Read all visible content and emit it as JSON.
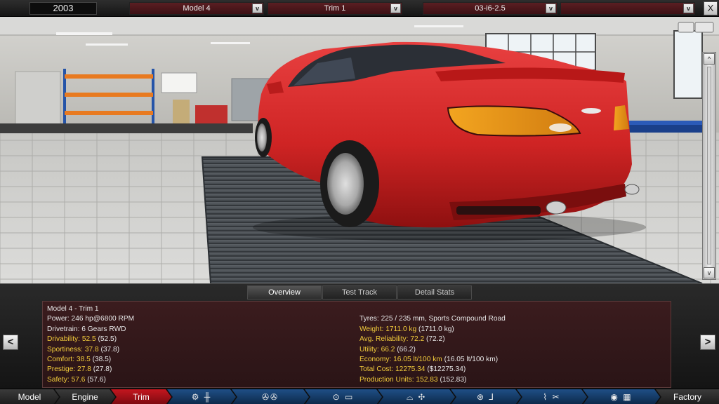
{
  "topbar": {
    "year": "2003",
    "model": "Model 4",
    "trim": "Trim 1",
    "engine": "03-i6-2.5",
    "extra": "",
    "dropdown_arrow": "v",
    "close_label": "X"
  },
  "viewport": {
    "scroll_up": "^",
    "scroll_down": "v"
  },
  "panel": {
    "tabs": [
      "Overview",
      "Test Track",
      "Detail Stats"
    ],
    "active_tab": "Overview",
    "prev_label": "<",
    "next_label": ">",
    "title": "Model 4 - Trim 1",
    "left": [
      {
        "label": "Power: 246 hp@6800 RPM",
        "value": "",
        "paren": "",
        "highlight": false
      },
      {
        "label": "Drivetrain: 6 Gears RWD",
        "value": "",
        "paren": "",
        "highlight": false
      },
      {
        "label": "Drivability:",
        "value": "52.5",
        "paren": "(52.5)",
        "highlight": true
      },
      {
        "label": "Sportiness:",
        "value": "37.8",
        "paren": "(37.8)",
        "highlight": true
      },
      {
        "label": "Comfort:",
        "value": "38.5",
        "paren": "(38.5)",
        "highlight": true
      },
      {
        "label": "Prestige:",
        "value": "27.8",
        "paren": "(27.8)",
        "highlight": true
      },
      {
        "label": "Safety:",
        "value": "57.6",
        "paren": "(57.6)",
        "highlight": true
      }
    ],
    "right": [
      {
        "label": "",
        "value": "",
        "paren": "",
        "highlight": false
      },
      {
        "label": "Tyres: 225 / 235 mm, Sports Compound Road",
        "value": "",
        "paren": "",
        "highlight": false
      },
      {
        "label": "Weight:",
        "value": "1711.0 kg",
        "paren": "(1711.0 kg)",
        "highlight": true
      },
      {
        "label": "Avg. Reliability:",
        "value": "72.2",
        "paren": "(72.2)",
        "highlight": true
      },
      {
        "label": "Utility:",
        "value": "66.2",
        "paren": "(66.2)",
        "highlight": true
      },
      {
        "label": "Economy:",
        "value": "16.05 lt/100 km",
        "paren": "(16.05 lt/100 km)",
        "highlight": true
      },
      {
        "label": "Total Cost:",
        "value": "12275.34",
        "paren": "($12275.34)",
        "highlight": true
      },
      {
        "label": "Production Units:",
        "value": "152.83",
        "paren": "(152.83)",
        "highlight": true
      }
    ]
  },
  "bottomnav": {
    "model": "Model",
    "engine": "Engine",
    "trim": "Trim",
    "factory": "Factory",
    "icons": [
      "gearbox-icon",
      "wheels-icon",
      "body-icon",
      "aero-icon",
      "interior-icon",
      "suspension-icon",
      "test-flag-icon"
    ]
  },
  "colors": {
    "accent_red": "#c4161f",
    "stat_yellow": "#f2cc3c",
    "panel_bg": "#3b1c1e",
    "car_red": "#d42a2a"
  }
}
